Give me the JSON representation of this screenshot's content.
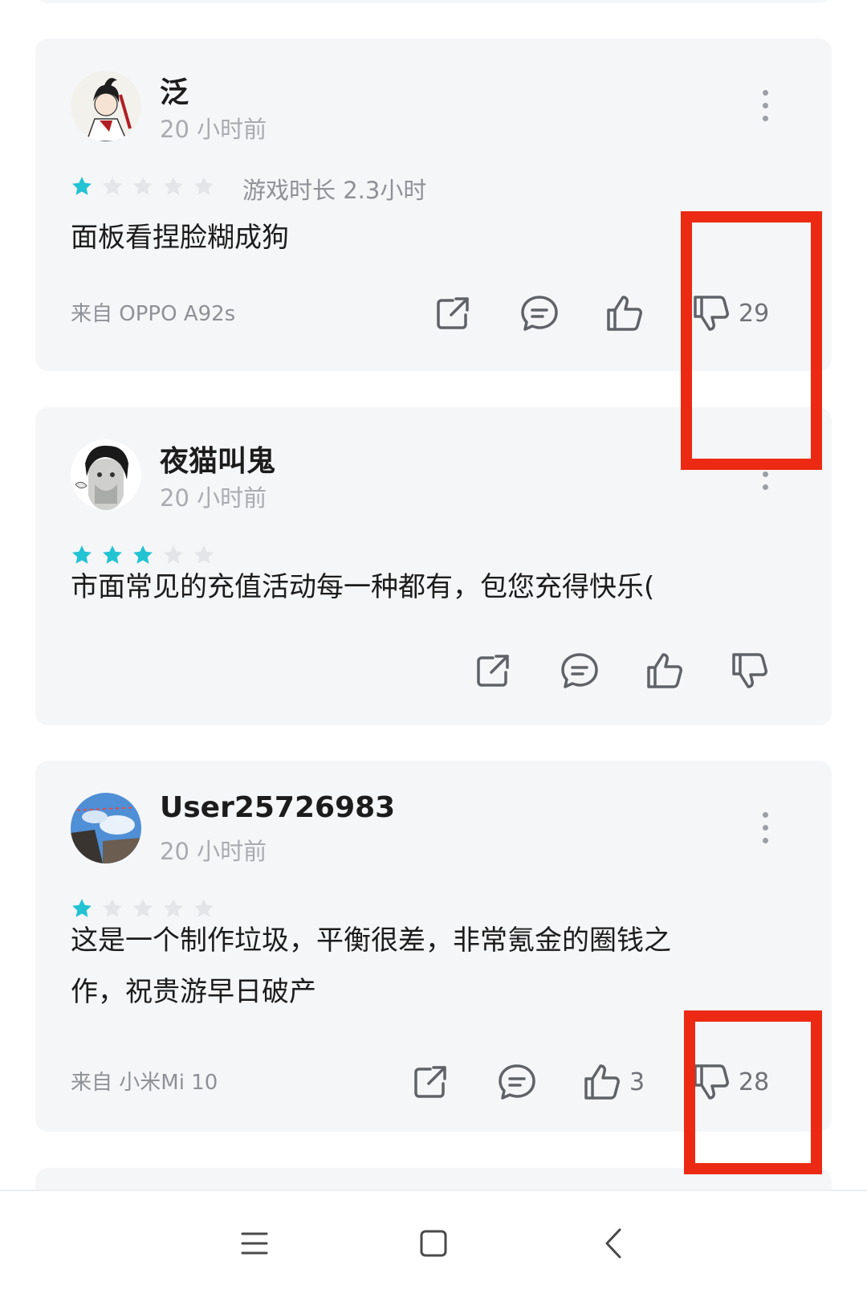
{
  "reviews": [
    {
      "username": "泛",
      "time": "20 小时前",
      "rating": 1,
      "max_rating": 5,
      "playtime": "游戏时长 2.3小时",
      "content": "面板看捏脸糊成狗",
      "source": "来自 OPPO A92s",
      "likes": "",
      "dislikes": "29"
    },
    {
      "username": "夜猫叫鬼",
      "time": "20 小时前",
      "rating": 3,
      "max_rating": 5,
      "content": "市面常见的充值活动每一种都有，包您充得快乐(",
      "likes": "",
      "dislikes": ""
    },
    {
      "username": "User25726983",
      "time": "20 小时前",
      "rating": 1,
      "max_rating": 5,
      "content_line1": "这是一个制作垃圾，平衡很差，非常氪金的圈钱之",
      "content_line2": "作，祝贵游早日破产",
      "source": "来自 小米Mi 10",
      "likes": "3",
      "dislikes": "28"
    }
  ],
  "colors": {
    "star_filled": "#22c3d2",
    "star_empty": "#e3e5e8",
    "highlight": "#ec2a13",
    "card_bg": "#f5f6f8"
  },
  "icons": [
    "share-icon",
    "comment-icon",
    "thumbs-up-icon",
    "thumbs-down-icon",
    "more-icon",
    "menu-icon",
    "home-icon",
    "back-icon"
  ]
}
